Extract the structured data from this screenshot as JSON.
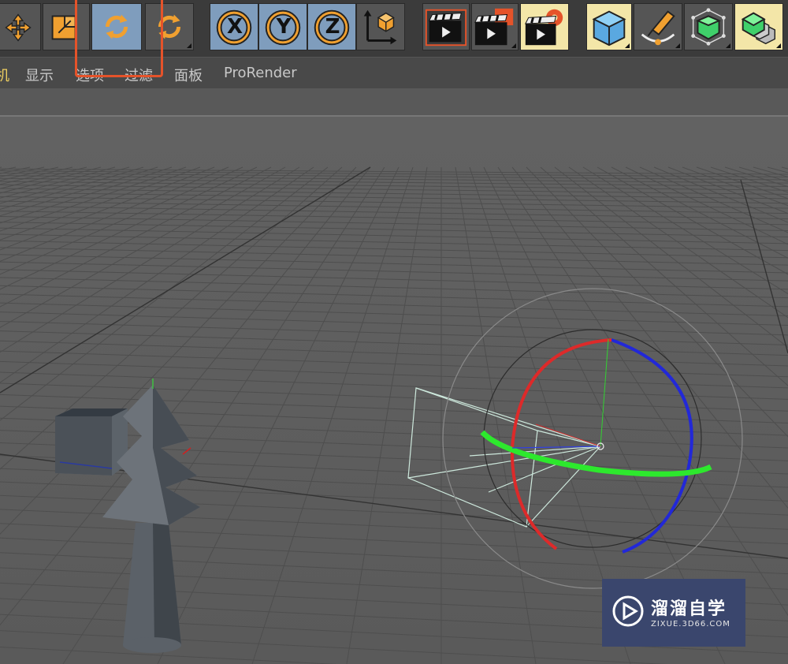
{
  "menu": {
    "items": [
      {
        "label": "机"
      },
      {
        "label": "显示"
      },
      {
        "label": "选项"
      },
      {
        "label": "过滤"
      },
      {
        "label": "面板"
      },
      {
        "label": "ProRender"
      }
    ]
  },
  "toolbar": {
    "tools": [
      {
        "icon": "move-icon"
      },
      {
        "icon": "scale-icon"
      },
      {
        "icon": "rotate-icon",
        "active": true
      },
      {
        "icon": "recent-tool-icon"
      },
      {
        "icon": "x-axis-lock-icon",
        "label": "X"
      },
      {
        "icon": "y-axis-lock-icon",
        "label": "Y"
      },
      {
        "icon": "z-axis-lock-icon",
        "label": "Z"
      },
      {
        "icon": "coordinate-system-icon"
      },
      {
        "icon": "render-view-icon"
      },
      {
        "icon": "render-to-picture-viewer-icon"
      },
      {
        "icon": "render-settings-icon"
      },
      {
        "icon": "cube-primitive-icon"
      },
      {
        "icon": "pen-spline-icon"
      },
      {
        "icon": "subdivision-surface-icon"
      },
      {
        "icon": "array-cloner-icon"
      }
    ],
    "axis_colors": {
      "active": "#7f9dbd",
      "accent": "#f0a030",
      "highlight": "#e5532a"
    }
  },
  "watermark": {
    "title": "溜溜自学",
    "url": "ZIXUE.3D66.COM"
  }
}
